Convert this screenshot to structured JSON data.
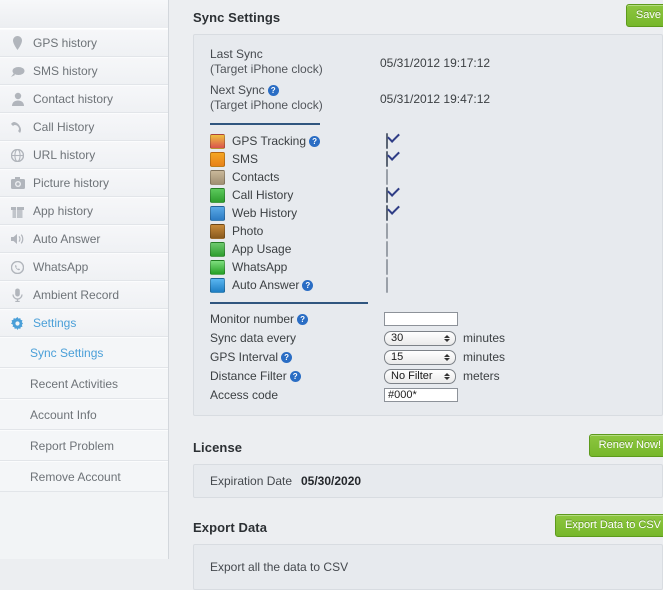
{
  "sidebar": {
    "items": [
      {
        "label": "GPS history",
        "icon": "pin-icon",
        "active": false
      },
      {
        "label": "SMS history",
        "icon": "speech-bubble-icon",
        "active": false
      },
      {
        "label": "Contact history",
        "icon": "person-icon",
        "active": false
      },
      {
        "label": "Call History",
        "icon": "phone-icon",
        "active": false
      },
      {
        "label": "URL history",
        "icon": "globe-icon",
        "active": false
      },
      {
        "label": "Picture history",
        "icon": "camera-icon",
        "active": false
      },
      {
        "label": "App history",
        "icon": "box-icon",
        "active": false
      },
      {
        "label": "Auto Answer",
        "icon": "speaker-icon",
        "active": false
      },
      {
        "label": "WhatsApp",
        "icon": "whatsapp-icon",
        "active": false
      },
      {
        "label": "Ambient Record",
        "icon": "microphone-icon",
        "active": false
      },
      {
        "label": "Settings",
        "icon": "gear-icon",
        "active": true
      }
    ],
    "subitems": [
      {
        "label": "Sync Settings",
        "active": true
      },
      {
        "label": "Recent Activities",
        "active": false
      },
      {
        "label": "Account Info",
        "active": false
      },
      {
        "label": "Report Problem",
        "active": false
      },
      {
        "label": "Remove Account",
        "active": false
      }
    ]
  },
  "sync": {
    "title": "Sync Settings",
    "save_label": "Save",
    "last_sync_label": "Last Sync",
    "last_sync_sub": "(Target iPhone clock)",
    "last_sync_value": "05/31/2012 19:17:12",
    "next_sync_label": "Next Sync",
    "next_sync_sub": "(Target iPhone clock)",
    "next_sync_value": "05/31/2012 19:47:12",
    "help_glyph": "?",
    "features": [
      {
        "name": "GPS Tracking",
        "checked": true,
        "help": true,
        "color": "#f0c040",
        "color2": "#d9534f"
      },
      {
        "name": "SMS",
        "checked": true,
        "help": false,
        "color": "#f5a623",
        "color2": "#e8821a"
      },
      {
        "name": "Contacts",
        "checked": false,
        "help": false,
        "color": "#c9b89a",
        "color2": "#a08f72"
      },
      {
        "name": "Call History",
        "checked": true,
        "help": false,
        "color": "#5cc95c",
        "color2": "#2f9e2f"
      },
      {
        "name": "Web History",
        "checked": true,
        "help": false,
        "color": "#5aa9e6",
        "color2": "#2d7cc4"
      },
      {
        "name": "Photo",
        "checked": false,
        "help": false,
        "color": "#c98b3a",
        "color2": "#8a5a1e"
      },
      {
        "name": "App Usage",
        "checked": false,
        "help": false,
        "color": "#6ec96e",
        "color2": "#2f9e2f"
      },
      {
        "name": "WhatsApp",
        "checked": false,
        "help": false,
        "color": "#7ede7e",
        "color2": "#25a025"
      },
      {
        "name": "Auto Answer",
        "checked": false,
        "help": true,
        "color": "#5ab6f0",
        "color2": "#1f7fc4"
      }
    ],
    "fields": {
      "monitor_number_label": "Monitor number",
      "monitor_number_value": "",
      "monitor_number_placeholder": "",
      "sync_every_label": "Sync data every",
      "sync_every_value": "30",
      "sync_every_unit": "minutes",
      "gps_interval_label": "GPS Interval",
      "gps_interval_value": "15",
      "gps_interval_unit": "minutes",
      "distance_filter_label": "Distance Filter",
      "distance_filter_value": "No Filter",
      "distance_filter_unit": "meters",
      "access_code_label": "Access code",
      "access_code_value": "#000*"
    }
  },
  "license": {
    "title": "License",
    "renew_label": "Renew Now!",
    "expiration_label": "Expiration Date",
    "expiration_value": "05/30/2020"
  },
  "export": {
    "title": "Export Data",
    "button_label": "Export Data to CSV",
    "description": "Export all the data to CSV"
  },
  "colors": {
    "accent_green": "#8dc63f",
    "accent_blue": "#4a9fd8",
    "divider_blue": "#30567f",
    "panel_bg": "#e7eaee",
    "page_bg": "#eceef1"
  }
}
